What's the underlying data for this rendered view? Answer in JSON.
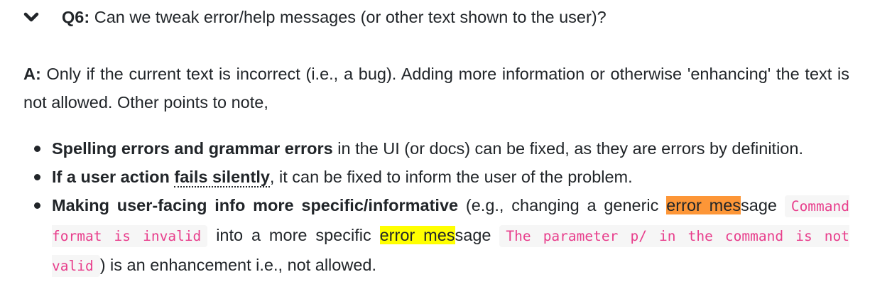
{
  "question": {
    "label": "Q6:",
    "text": "Can we tweak error/help messages (or other text shown to the user)?"
  },
  "answer": {
    "label": "A:",
    "text": "Only if the current text is incorrect (i.e., a bug). Adding more information or otherwise 'enhancing' the text is not allowed. Other points to note,"
  },
  "points": [
    {
      "bold": "Spelling errors and grammar errors",
      "rest": "in the UI (or docs) can be fixed, as they are errors by definition."
    },
    {
      "bold_prefix": "If a user action",
      "bold_dotted": "fails silently",
      "rest": ", it can be fixed to inform the user of the problem."
    },
    {
      "bold": "Making user-facing info more specific/informative",
      "t1": "(e.g., changing a generic",
      "hl1a": "error mes",
      "hl1b": "sage",
      "code1": "Command format is invalid",
      "t2": "into a more specific",
      "hl2a": "error mes",
      "hl2b": "sage",
      "code2": "The parameter p/ in the command is not valid",
      "t3": ") is an enhancement i.e., not allowed."
    }
  ],
  "colors": {
    "highlight_orange": "#fd9637",
    "highlight_yellow": "#ffff00",
    "code_text": "#e83e8c",
    "code_bg": "#f6f6f6"
  },
  "icons": {
    "toggle": "chevron-down-icon"
  }
}
